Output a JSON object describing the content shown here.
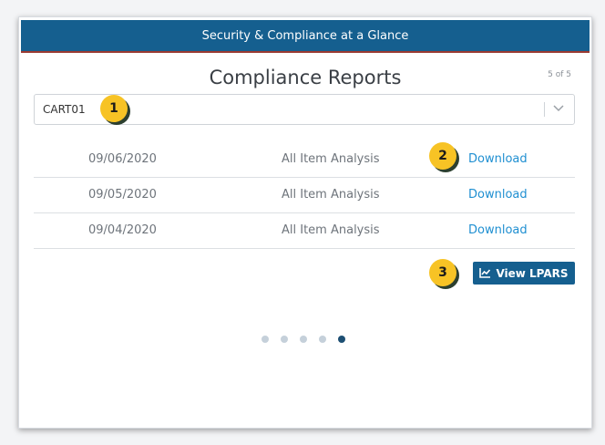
{
  "header": {
    "title": "Security & Compliance at a Glance"
  },
  "main": {
    "title": "Compliance Reports",
    "page_count": "5 of 5",
    "cart_select": {
      "value": "CART01"
    },
    "rows": [
      {
        "date": "09/06/2020",
        "type": "All Item Analysis",
        "action": "Download"
      },
      {
        "date": "09/05/2020",
        "type": "All Item Analysis",
        "action": "Download"
      },
      {
        "date": "09/04/2020",
        "type": "All Item Analysis",
        "action": "Download"
      }
    ],
    "view_button": {
      "label": "View LPARS",
      "icon": "line-chart-icon"
    }
  },
  "callouts": [
    "1",
    "2",
    "3"
  ],
  "pagination": {
    "total": 5,
    "active_index": 4
  },
  "colors": {
    "header_bg": "#155f8f",
    "link": "#1f8fd1",
    "badge": "#f7c325",
    "dot_active": "#1d4f73",
    "dot_inactive": "#c5d0da"
  }
}
